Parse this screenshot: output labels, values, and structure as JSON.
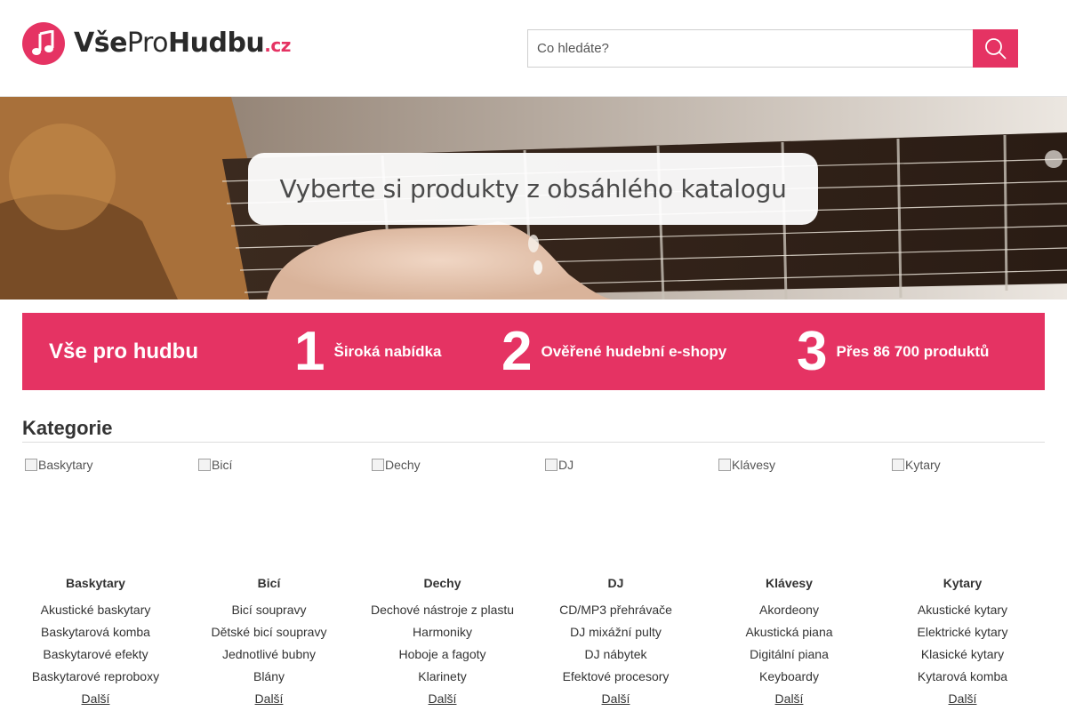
{
  "header": {
    "logo": {
      "part1": "Vše",
      "part2": "Pro",
      "part3": "Hudbu",
      "tld": ".cz"
    },
    "search": {
      "placeholder": "Co hledáte?",
      "value": ""
    }
  },
  "hero": {
    "banner_text": "Vyberte si produkty z obsáhlého katalogu"
  },
  "usp": {
    "title": "Vše pro hudbu",
    "items": [
      {
        "number": "1",
        "label": "Široká nabídka"
      },
      {
        "number": "2",
        "label": "Ověřené hudební e-shopy"
      },
      {
        "number": "3",
        "label": "Přes 86 700 produktů"
      }
    ]
  },
  "categories": {
    "heading": "Kategorie",
    "more_label": "Další",
    "items": [
      {
        "name": "Baskytary",
        "image_alt": "Baskytary",
        "links": [
          "Akustické baskytary",
          "Baskytarová komba",
          "Baskytarové efekty",
          "Baskytarové reproboxy"
        ]
      },
      {
        "name": "Bicí",
        "image_alt": "Bicí",
        "links": [
          "Bicí soupravy",
          "Dětské bicí soupravy",
          "Jednotlivé bubny",
          "Blány"
        ]
      },
      {
        "name": "Dechy",
        "image_alt": "Dechy",
        "links": [
          "Dechové nástroje z plastu",
          "Harmoniky",
          "Hoboje a fagoty",
          "Klarinety"
        ]
      },
      {
        "name": "DJ",
        "image_alt": "DJ",
        "links": [
          "CD/MP3 přehrávače",
          "DJ mixážní pulty",
          "DJ nábytek",
          "Efektové procesory"
        ]
      },
      {
        "name": "Klávesy",
        "image_alt": "Klávesy",
        "links": [
          "Akordeony",
          "Akustická piana",
          "Digitální piana",
          "Keyboardy"
        ]
      },
      {
        "name": "Kytary",
        "image_alt": "Kytary",
        "links": [
          "Akustické kytary",
          "Elektrické kytary",
          "Klasické kytary",
          "Kytarová komba"
        ]
      }
    ]
  },
  "colors": {
    "brand": "#e53363",
    "text": "#333333"
  }
}
